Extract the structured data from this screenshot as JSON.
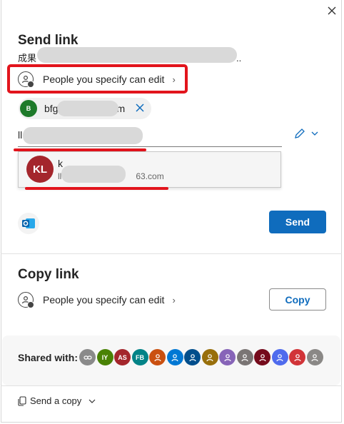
{
  "dialog": {
    "close_icon": "close-icon",
    "title": "Send link",
    "subtitle_prefix": "成果",
    "subtitle_suffix": ".."
  },
  "send_section": {
    "permission_label": "People you specify can edit",
    "recipient_chip": {
      "initial": "B",
      "text_prefix": "bfg",
      "text_suffix": "m",
      "avatar_color": "#1e7a2a"
    },
    "input_prefix": "ll",
    "suggestion": {
      "initials": "KL",
      "name_prefix": "k",
      "email_prefix": "ll",
      "email_suffix": "63.com",
      "avatar_color": "#a4262c"
    },
    "send_label": "Send"
  },
  "copy_section": {
    "title": "Copy link",
    "permission_label": "People you specify can edit",
    "copy_label": "Copy"
  },
  "shared_with": {
    "label": "Shared with:",
    "avatars": [
      {
        "text": "",
        "color": "#8a8a8a",
        "icon": "link-icon"
      },
      {
        "text": "IY",
        "color": "#498205",
        "icon": ""
      },
      {
        "text": "AS",
        "color": "#a4262c",
        "icon": ""
      },
      {
        "text": "FB",
        "color": "#038387",
        "icon": ""
      },
      {
        "text": "",
        "color": "#ca5010",
        "icon": "person-icon"
      },
      {
        "text": "",
        "color": "#0078d4",
        "icon": "person-icon"
      },
      {
        "text": "",
        "color": "#004e8c",
        "icon": "person-icon"
      },
      {
        "text": "",
        "color": "#986f0b",
        "icon": "person-icon"
      },
      {
        "text": "",
        "color": "#8764b8",
        "icon": "person-icon"
      },
      {
        "text": "",
        "color": "#7a7574",
        "icon": "person-icon"
      },
      {
        "text": "",
        "color": "#750b1c",
        "icon": "person-icon"
      },
      {
        "text": "",
        "color": "#4f6bed",
        "icon": "person-icon"
      },
      {
        "text": "",
        "color": "#d13438",
        "icon": "person-icon"
      },
      {
        "text": "",
        "color": "#8a8886",
        "icon": "person-icon"
      }
    ]
  },
  "footer": {
    "send_copy_label": "Send a copy"
  },
  "colors": {
    "accent": "#0f6cbd",
    "annotation_red": "#e2141c"
  }
}
